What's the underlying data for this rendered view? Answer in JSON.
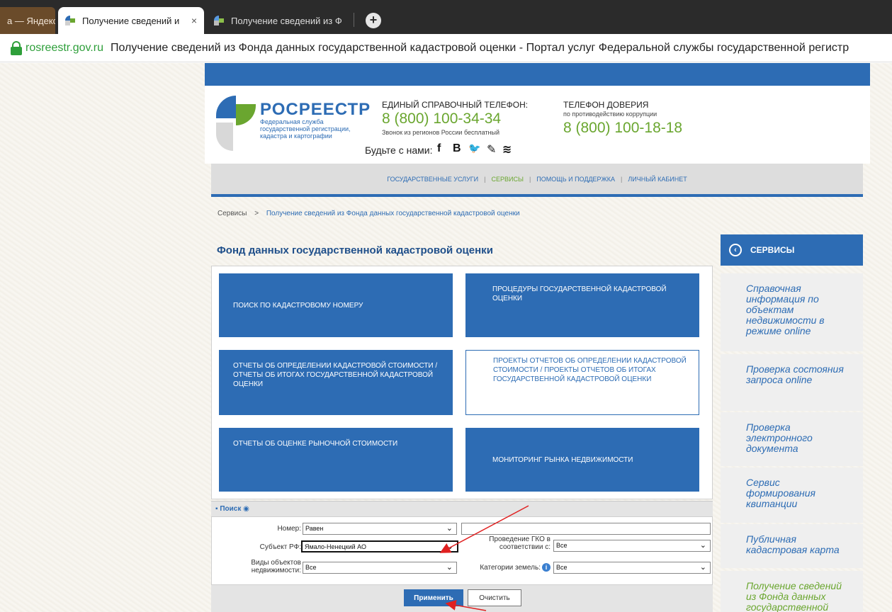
{
  "browser": {
    "tabs": [
      {
        "label": "а — Яндекс"
      },
      {
        "label": "Получение сведений и"
      },
      {
        "label": "Получение сведений из Ф"
      }
    ],
    "close_glyph": "×",
    "new_tab_glyph": "+",
    "address": {
      "domain": "rosreestr.gov.ru",
      "title": "Получение сведений из Фонда данных государственной кадастровой оценки - Портал услуг Федеральной службы государственной регистр"
    }
  },
  "header": {
    "brand": "РОСРЕЕСТР",
    "brand_subtitle": "Федеральная служба государственной регистрации, кадастра и картографии",
    "hotline_label": "ЕДИНЫЙ СПРАВОЧНЫЙ ТЕЛЕФОН:",
    "hotline_number": "8 (800) 100-34-34",
    "hotline_note": "Звонок из регионов России бесплатный",
    "trust_label": "ТЕЛЕФОН ДОВЕРИЯ",
    "trust_sub": "по противодействию коррупции",
    "trust_number": "8 (800) 100-18-18",
    "social_label": "Будьте с нами:",
    "social_icons": [
      "f",
      "B",
      "🐦",
      "✎",
      "≋"
    ]
  },
  "nav": {
    "items": [
      {
        "label": "ГОСУДАРСТВЕННЫЕ УСЛУГИ"
      },
      {
        "label": "СЕРВИСЫ"
      },
      {
        "label": "ПОМОЩЬ И ПОДДЕРЖКА"
      },
      {
        "label": "ЛИЧНЫЙ КАБИНЕТ"
      }
    ],
    "separator": "|"
  },
  "breadcrumb": {
    "root": "Сервисы",
    "separator": ">",
    "current": "Получение сведений из Фонда данных государственной кадастровой оценки"
  },
  "main": {
    "title": "Фонд данных государственной кадастровой оценки",
    "tiles": [
      {
        "label": "ПОИСК ПО КАДАСТРОВОМУ НОМЕРУ"
      },
      {
        "label": "ПРОЦЕДУРЫ ГОСУДАРСТВЕННОЙ КАДАСТРОВОЙ ОЦЕНКИ"
      },
      {
        "label": "ОТЧЕТЫ ОБ ОПРЕДЕЛЕНИИ КАДАСТРОВОЙ СТОИМОСТИ / ОТЧЕТЫ ОБ ИТОГАХ ГОСУДАРСТВЕННОЙ КАДАСТРОВОЙ ОЦЕНКИ"
      },
      {
        "label": "ПРОЕКТЫ ОТЧЕТОВ ОБ ОПРЕДЕЛЕНИИ КАДАСТРОВОЙ СТОИМОСТИ / ПРОЕКТЫ ОТЧЕТОВ ОБ ИТОГАХ ГОСУДАРСТВЕННОЙ КАДАСТРОВОЙ ОЦЕНКИ"
      },
      {
        "label": "ОТЧЕТЫ ОБ ОЦЕНКЕ РЫНОЧНОЙ СТОИМОСТИ"
      },
      {
        "label": "МОНИТОРИНГ РЫНКА НЕДВИЖИМОСТИ"
      }
    ]
  },
  "search": {
    "header": "▪ Поиск ◉",
    "number_label": "Номер:",
    "number_op": "Равен",
    "number_value": "",
    "subject_label": "Субъект РФ:",
    "subject_value": "Ямало-Ненецкий АО",
    "gko_label": "Проведение ГКО в соответствии с:",
    "gko_value": "Все",
    "object_types_label": "Виды объектов недвижимости:",
    "object_types_value": "Все",
    "land_category_label": "Категории земель:",
    "land_category_value": "Все",
    "apply": "Применить",
    "clear": "Очистить",
    "chevron": "⌄",
    "info": "i"
  },
  "sidebar": {
    "title": "СЕРВИСЫ",
    "chevron": "‹",
    "items": [
      {
        "label": "Справочная информация по объектам недвижимости в режиме online"
      },
      {
        "label": "Проверка состояния запроса online"
      },
      {
        "label": "Проверка электронного документа"
      },
      {
        "label": "Сервис формирования квитанции"
      },
      {
        "label": "Публичная кадастровая карта"
      },
      {
        "label": "Получение сведений из Фонда данных государственной"
      }
    ]
  },
  "colors": {
    "brand_blue": "#2d6cb4",
    "brand_green": "#6aa62f",
    "annotation_red": "#e02020"
  }
}
